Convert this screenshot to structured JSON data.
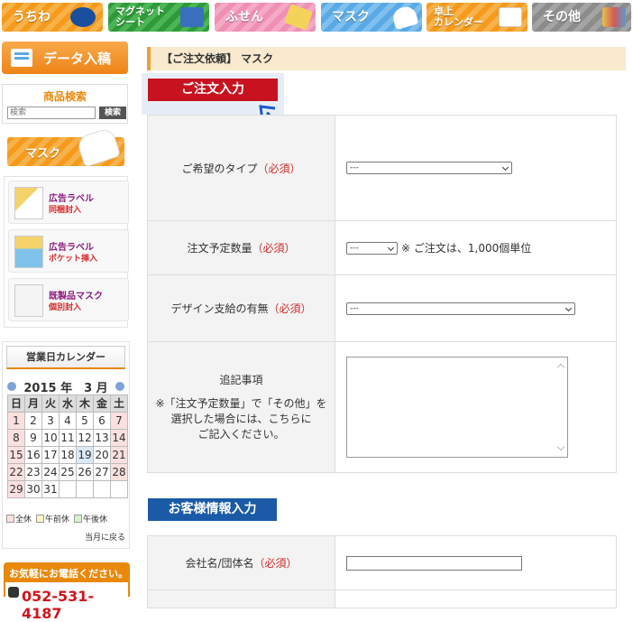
{
  "topnav": [
    {
      "label": "うちわ",
      "color": "#f59a1c"
    },
    {
      "label": "マグネット\nシート",
      "color": "#2e9a3a"
    },
    {
      "label": "ふせん",
      "color": "#ee8fb3"
    },
    {
      "label": "マスク",
      "color": "#5aa9e6"
    },
    {
      "label": "卓上\nカレンダー",
      "color": "#f59a1c"
    },
    {
      "label": "その他",
      "color": "#8c8c8c"
    }
  ],
  "sidebar": {
    "data_button": "データ入稿",
    "search": {
      "title": "商品検索",
      "placeholder": "検索",
      "button": "検索"
    },
    "category_banner": "マスク",
    "products": [
      {
        "line1": "広告ラベル",
        "line2": "同梱封入"
      },
      {
        "line1": "広告ラベル",
        "line2": "ポケット挿入"
      },
      {
        "line1": "既製品マスク",
        "line2": "個別封入"
      }
    ],
    "calendar": {
      "title": "営業日カレンダー",
      "month": "2015 年　3 月",
      "weekdays": [
        "日",
        "月",
        "火",
        "水",
        "木",
        "金",
        "土"
      ],
      "weeks": [
        [
          "1",
          "2",
          "3",
          "4",
          "5",
          "6",
          "7"
        ],
        [
          "8",
          "9",
          "10",
          "11",
          "12",
          "13",
          "14"
        ],
        [
          "15",
          "16",
          "17",
          "18",
          "19",
          "20",
          "21"
        ],
        [
          "22",
          "23",
          "24",
          "25",
          "26",
          "27",
          "28"
        ],
        [
          "29",
          "30",
          "31",
          "",
          "",
          "",
          ""
        ]
      ],
      "legend": [
        "全休",
        "午前休",
        "午後休"
      ],
      "back_link": "当月に戻る"
    },
    "phone": {
      "label": "お気軽にお電話ください。",
      "number": "052-531-4187"
    }
  },
  "main": {
    "breadcrumb": "【ご注文依頼】 マスク",
    "order_section_title": "ご注文入力",
    "required_mark": "（必須）",
    "order_fields": {
      "type_label": "ご希望のタイプ",
      "type_value": "---",
      "qty_label": "注文予定数量",
      "qty_value": "---",
      "qty_note": "※ ご注文は、1,000個単位",
      "design_label": "デザイン支給の有無",
      "design_value": "---",
      "notes_label": "追記事項",
      "notes_help": "※「注文予定数量」で「その他」を\n選択した場合には、こちらに\nご記入ください。"
    },
    "customer_section_title": "お客様情報入力",
    "customer_fields": {
      "company_label": "会社名/団体名",
      "company_value": ""
    }
  }
}
